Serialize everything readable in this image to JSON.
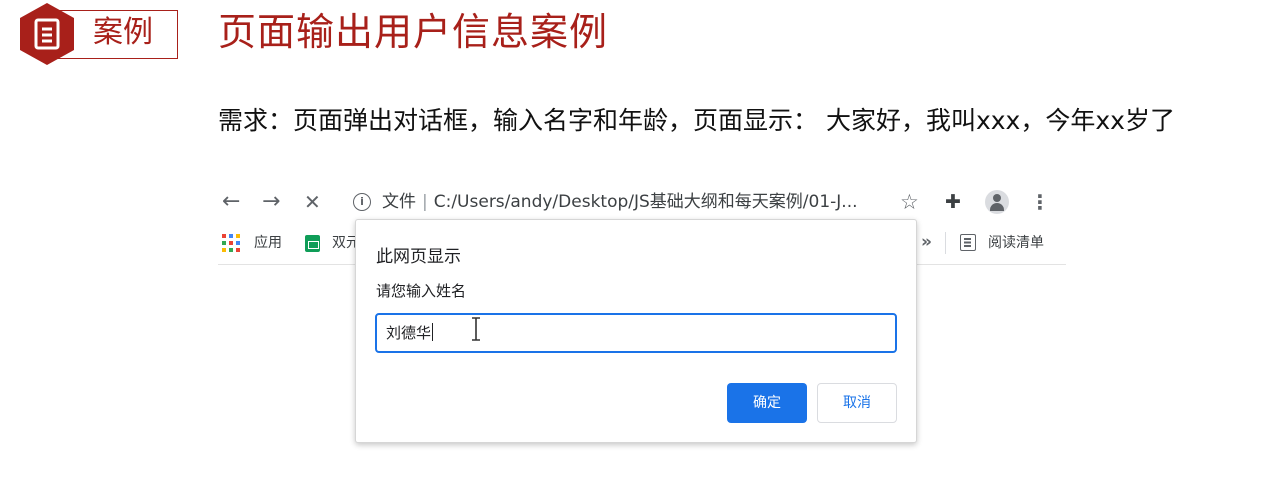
{
  "slide": {
    "tag": "案例",
    "title": "页面输出用户信息案例",
    "requirement_label": "需求：",
    "requirement_text": "页面弹出对话框，输入名字和年龄，页面显示： 大家好，我叫xxx，今年xx岁了",
    "accent_color": "#a8201a"
  },
  "browser": {
    "nav": {
      "back": "←",
      "forward": "→",
      "stop": "✕"
    },
    "address_scheme": "文件",
    "address_url": "C:/Users/andy/Desktop/JS基础大纲和每天案例/01-J...",
    "bookmarks": {
      "apps": "应用",
      "item2": "双元",
      "overflow": "»",
      "reading_list": "阅读清单"
    }
  },
  "dialog": {
    "title": "此网页显示",
    "message": "请您输入姓名",
    "input_value": "刘德华",
    "ok_label": "确定",
    "cancel_label": "取消",
    "accent_color": "#1a73e8"
  }
}
